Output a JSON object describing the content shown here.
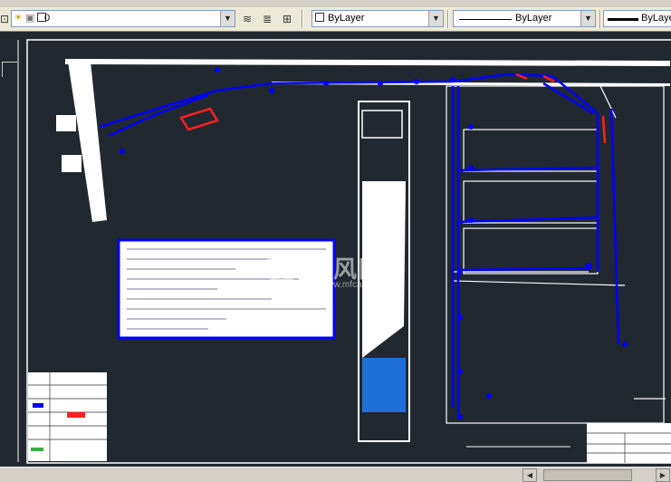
{
  "toolbar": {
    "layer_value": "0",
    "color_value": "ByLayer",
    "linetype_value": "ByLayer",
    "lineweight_value": "ByLayer"
  },
  "icons": {
    "layer_state": "layer-state-icon",
    "layer_states_manager": "layer-states-manager-icon",
    "make_current": "make-object-layer-current-icon",
    "layer_previous": "layer-previous-icon",
    "lightbulb": "layer-on-off-icon",
    "sun": "freeze-thaw-icon",
    "lock": "lock-unlock-icon",
    "color_swatch": "color-swatch-icon"
  },
  "watermark": {
    "text": "沐风网",
    "url": "www.mfcad.com"
  },
  "colors": {
    "canvas": "#212830",
    "linework": "#ffffff",
    "pipes": "#0000ff",
    "markers": "#ff0000",
    "water": "#1e6fd8"
  }
}
